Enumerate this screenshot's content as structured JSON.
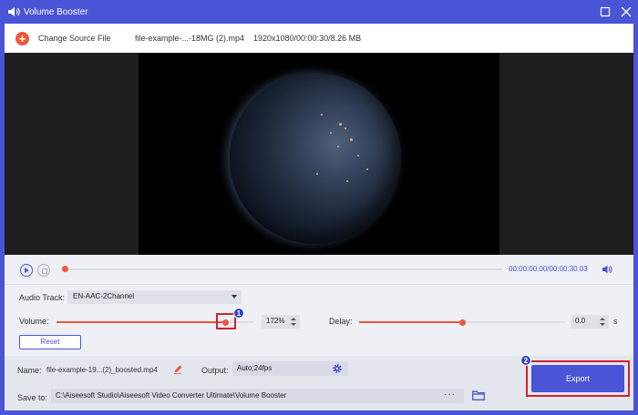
{
  "window": {
    "title": "Volume Booster"
  },
  "source": {
    "change_label": "Change Source File",
    "file_name": "file-example-...-18MG (2).mp4",
    "file_meta": "1920x1080/00:00:30/8.26 MB"
  },
  "playback": {
    "time": "00:00:00.00/00:00:30.03",
    "progress": 0.0
  },
  "audio": {
    "track_label": "Audio Track:",
    "track_value": "EN-AAC-2Channel",
    "volume_label": "Volume:",
    "volume_value": "172%",
    "volume_level": 0.86,
    "delay_label": "Delay:",
    "delay_value": "0.0",
    "delay_unit": "s",
    "delay_level": 0.5,
    "reset_label": "Reset"
  },
  "output": {
    "name_label": "Name:",
    "name_value": "file-example-19...(2)_boosted.mp4",
    "output_label": "Output:",
    "output_value": "Auto;24fps",
    "save_label": "Save to:",
    "save_path": "C:\\Aiseesoft Studio\\Aiseesoft Video Converter Ultimate\\Volume Booster",
    "browse_label": "···",
    "export_label": "Export"
  },
  "annotations": {
    "step1": "1",
    "step2": "2"
  },
  "colors": {
    "accent": "#4a54d6",
    "slider": "#f0563a",
    "highlight": "#d0222a"
  }
}
